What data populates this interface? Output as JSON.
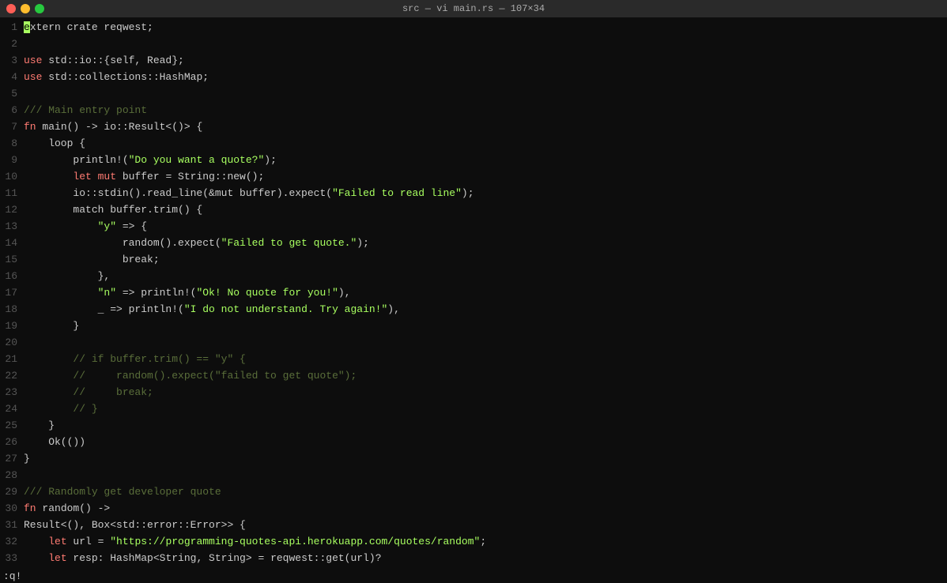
{
  "titleBar": {
    "title": "src — vi main.rs — 107×34"
  },
  "statusBar": {
    "text": ":q!"
  },
  "lines": [
    {
      "num": "1",
      "tokens": [
        {
          "t": "cursor",
          "v": "e"
        },
        {
          "t": "plain",
          "v": "xtern crate reqwest;"
        }
      ]
    },
    {
      "num": "2",
      "tokens": []
    },
    {
      "num": "3",
      "tokens": [
        {
          "t": "kw",
          "v": "use"
        },
        {
          "t": "plain",
          "v": " std::io::{self, Read};"
        }
      ]
    },
    {
      "num": "4",
      "tokens": [
        {
          "t": "kw",
          "v": "use"
        },
        {
          "t": "plain",
          "v": " std::collections::HashMap;"
        }
      ]
    },
    {
      "num": "5",
      "tokens": []
    },
    {
      "num": "6",
      "tokens": [
        {
          "t": "comment",
          "v": "/// Main entry point"
        }
      ]
    },
    {
      "num": "7",
      "tokens": [
        {
          "t": "kw",
          "v": "fn"
        },
        {
          "t": "plain",
          "v": " main() -> io::Result<()> {"
        }
      ]
    },
    {
      "num": "8",
      "tokens": [
        {
          "t": "plain",
          "v": "    loop {"
        }
      ]
    },
    {
      "num": "9",
      "tokens": [
        {
          "t": "plain",
          "v": "        println!("
        },
        {
          "t": "string",
          "v": "\"Do you want a quote?\""
        },
        {
          "t": "plain",
          "v": ");"
        }
      ]
    },
    {
      "num": "10",
      "tokens": [
        {
          "t": "plain",
          "v": "        "
        },
        {
          "t": "kw",
          "v": "let mut"
        },
        {
          "t": "plain",
          "v": " buffer = String::new();"
        }
      ]
    },
    {
      "num": "11",
      "tokens": [
        {
          "t": "plain",
          "v": "        io::stdin().read_line(&mut buffer).expect("
        },
        {
          "t": "string",
          "v": "\"Failed to read line\""
        },
        {
          "t": "plain",
          "v": "); "
        }
      ]
    },
    {
      "num": "12",
      "tokens": [
        {
          "t": "plain",
          "v": "        match buffer.trim() {"
        }
      ]
    },
    {
      "num": "13",
      "tokens": [
        {
          "t": "plain",
          "v": "            "
        },
        {
          "t": "string",
          "v": "\"y\""
        },
        {
          "t": "plain",
          "v": " => {"
        }
      ]
    },
    {
      "num": "14",
      "tokens": [
        {
          "t": "plain",
          "v": "                random().expect("
        },
        {
          "t": "string",
          "v": "\"Failed to get quote.\""
        },
        {
          "t": "plain",
          "v": ");"
        }
      ]
    },
    {
      "num": "15",
      "tokens": [
        {
          "t": "plain",
          "v": "                break;"
        }
      ]
    },
    {
      "num": "16",
      "tokens": [
        {
          "t": "plain",
          "v": "            },"
        }
      ]
    },
    {
      "num": "17",
      "tokens": [
        {
          "t": "plain",
          "v": "            "
        },
        {
          "t": "string",
          "v": "\"n\""
        },
        {
          "t": "plain",
          "v": " => println!("
        },
        {
          "t": "string",
          "v": "\"Ok! No quote for you!\""
        },
        {
          "t": "plain",
          "v": "),"
        }
      ]
    },
    {
      "num": "18",
      "tokens": [
        {
          "t": "plain",
          "v": "            _ => println!("
        },
        {
          "t": "string",
          "v": "\"I do not understand. Try again!\""
        },
        {
          "t": "plain",
          "v": "),"
        }
      ]
    },
    {
      "num": "19",
      "tokens": [
        {
          "t": "plain",
          "v": "        }"
        }
      ]
    },
    {
      "num": "20",
      "tokens": []
    },
    {
      "num": "21",
      "tokens": [
        {
          "t": "comment",
          "v": "        // if buffer.trim() == \"y\" {"
        }
      ]
    },
    {
      "num": "22",
      "tokens": [
        {
          "t": "comment",
          "v": "        //     random().expect(\"failed to get quote\");"
        }
      ]
    },
    {
      "num": "23",
      "tokens": [
        {
          "t": "comment",
          "v": "        //     break;"
        }
      ]
    },
    {
      "num": "24",
      "tokens": [
        {
          "t": "comment",
          "v": "        // }"
        }
      ]
    },
    {
      "num": "25",
      "tokens": [
        {
          "t": "plain",
          "v": "    }"
        }
      ]
    },
    {
      "num": "26",
      "tokens": [
        {
          "t": "plain",
          "v": "    Ok(())"
        }
      ]
    },
    {
      "num": "27",
      "tokens": [
        {
          "t": "plain",
          "v": "}"
        }
      ]
    },
    {
      "num": "28",
      "tokens": []
    },
    {
      "num": "29",
      "tokens": [
        {
          "t": "comment",
          "v": "/// Randomly get developer quote"
        }
      ]
    },
    {
      "num": "30",
      "tokens": [
        {
          "t": "kw",
          "v": "fn"
        },
        {
          "t": "plain",
          "v": " random() ->"
        }
      ]
    },
    {
      "num": "31",
      "tokens": [
        {
          "t": "plain",
          "v": "Result<(), Box<std::error::Error>> {"
        }
      ]
    },
    {
      "num": "32",
      "tokens": [
        {
          "t": "plain",
          "v": "    "
        },
        {
          "t": "kw",
          "v": "let"
        },
        {
          "t": "plain",
          "v": " url = "
        },
        {
          "t": "string",
          "v": "\"https://programming-quotes-api.herokuapp.com/quotes/random\""
        },
        {
          "t": "plain",
          "v": ";"
        }
      ]
    },
    {
      "num": "33",
      "tokens": [
        {
          "t": "plain",
          "v": "    "
        },
        {
          "t": "kw",
          "v": "let"
        },
        {
          "t": "plain",
          "v": " resp: HashMap<String, String> = reqwest::get(url)?"
        }
      ]
    }
  ]
}
